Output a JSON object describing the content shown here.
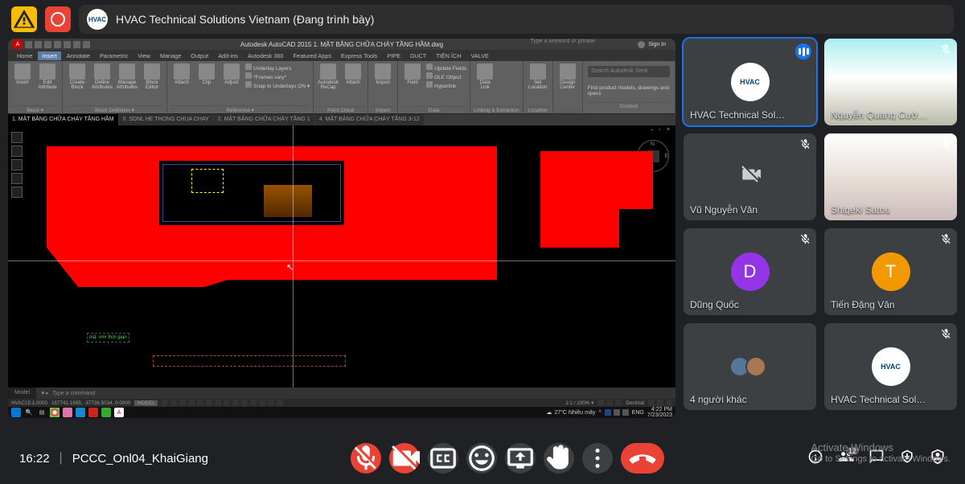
{
  "topbar": {
    "presenter_avatar_text": "HVAC",
    "title": "HVAC Technical Solutions Vietnam (Đang trình bày)"
  },
  "autocad": {
    "app_title": "Autodesk AutoCAD 2015   1. MẶT BẰNG CHỮA CHÁY TẦNG HẦM.dwg",
    "search_placeholder": "Type a keyword or phrase",
    "signin": "Sign In",
    "menu_tabs": [
      "Home",
      "Insert",
      "Annotate",
      "Parametric",
      "View",
      "Manage",
      "Output",
      "Add-ins",
      "Autodesk 360",
      "Featured Apps",
      "Express Tools",
      "PIPE",
      "DUCT",
      "TIỆN ÍCH",
      "VALVE"
    ],
    "menu_active": "Insert",
    "ribbon": {
      "groups": [
        {
          "label": "Block ▾",
          "items": [
            "Insert",
            "Edit Attribute"
          ]
        },
        {
          "label": "Block Definition ▾",
          "items": [
            "Create Block",
            "Define Attributes",
            "Manage Attributes",
            "Block Editor"
          ]
        },
        {
          "label": "Reference ▾",
          "items": [
            "Attach",
            "Clip",
            "Adjust"
          ],
          "small": [
            "Underlay Layers",
            "*Frames vary*",
            "Snap to Underlays ON ▾"
          ]
        },
        {
          "label": "Point Cloud",
          "items": [
            "Autodesk ReCap",
            "Attach"
          ]
        },
        {
          "label": "Import",
          "items": [
            "Import"
          ]
        },
        {
          "label": "Data",
          "items": [
            "Field"
          ],
          "small": [
            "Update Fields",
            "OLE Object",
            "Hyperlink"
          ]
        },
        {
          "label": "Linking & Extraction",
          "items": [
            "Data Link"
          ]
        },
        {
          "label": "Location",
          "items": [
            "Set Location"
          ]
        },
        {
          "label": "",
          "items": [
            "Design Center"
          ]
        },
        {
          "label": "Content",
          "search": "Search Autodesk Seek",
          "desc": "Find product models, drawings and specs"
        }
      ]
    },
    "file_tabs": [
      "1. MẶT BẰNG CHỮA CHÁY TẦNG HẦM",
      "0. SDNL HE THONG CHUA CHAY",
      "2. MẶT BẰNG CHỮA CHÁY TẦNG 1",
      "4. MẶT BẰNG CHỮA CHÁY TẦNG 3-12"
    ],
    "file_tab_active": 0,
    "annot": "mã: ###\nthời gian",
    "cmd_prompt": "Type a command",
    "model_tab": "Model",
    "status": {
      "layer": "HVAC15:1.0000",
      "coords": "167741.1995, -37736.5034, 0.0000",
      "mode": "MODEL",
      "scale": "1:1 / 100% ▾",
      "decimal": "Decimal"
    },
    "taskbar": {
      "weather": "27°C  Nhiều mây",
      "lang": "ENG",
      "time": "4:22 PM",
      "date": "7/23/2023"
    }
  },
  "participants": [
    {
      "name": "HVAC Technical Sol…",
      "type": "logo",
      "speaking": true,
      "presenting": true
    },
    {
      "name": "Nguyễn Quang Cườ…",
      "type": "video1",
      "muted": true
    },
    {
      "name": "Vũ Nguyễn Văn",
      "type": "camoff",
      "muted": true
    },
    {
      "name": "Shigeki Satou",
      "type": "video2",
      "muted": true
    },
    {
      "name": "Dũng Quốc",
      "type": "letter",
      "letter": "D",
      "color": "#9334e6",
      "muted": true
    },
    {
      "name": "Tiến Đặng Văn",
      "type": "letter",
      "letter": "T",
      "color": "#f29900",
      "muted": true
    },
    {
      "name": "4 người khác",
      "type": "many"
    },
    {
      "name": "HVAC Technical Sol…",
      "type": "logo",
      "muted": true
    }
  ],
  "bottom": {
    "time": "16:22",
    "meeting": "PCCC_Onl04_KhaiGiang",
    "badge": "12"
  },
  "activate": {
    "line1": "Activate Windows",
    "line2": "Go to Settings to activate Windows."
  }
}
